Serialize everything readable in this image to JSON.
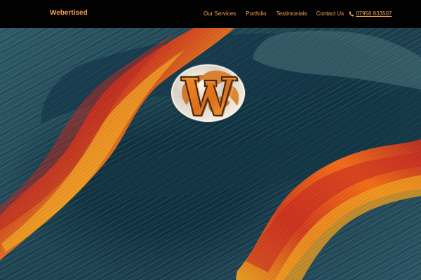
{
  "brand": {
    "name": "Webertised"
  },
  "navigation": {
    "items": [
      {
        "label": "Our Services"
      },
      {
        "label": "Portfolio"
      },
      {
        "label": "Testimonials"
      },
      {
        "label": "Contact Us"
      }
    ],
    "phone": "07956 833507",
    "phone_icon": "phone-icon"
  },
  "hero": {
    "logo_icon": "webertised-w-globe-logo",
    "colors": {
      "background": "#1e3f50",
      "accent_orange": "#f1a047",
      "flame_red": "#c92d22",
      "flame_yellow": "#f7a824"
    }
  }
}
